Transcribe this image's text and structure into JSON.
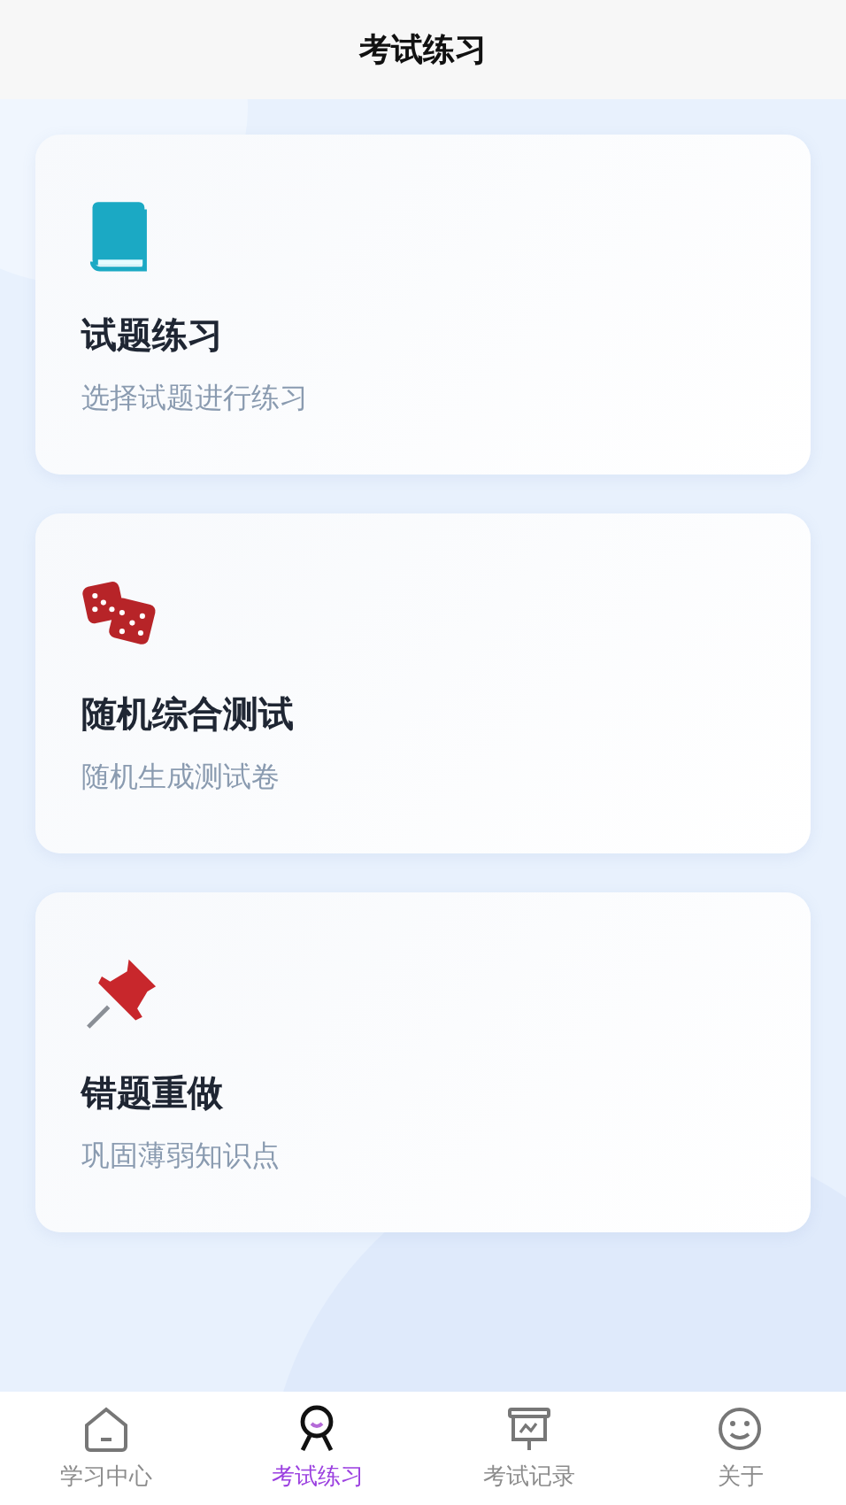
{
  "header": {
    "title": "考试练习"
  },
  "cards": [
    {
      "kind": "book",
      "title": "试题练习",
      "subtitle": "选择试题进行练习"
    },
    {
      "kind": "dice",
      "title": "随机综合测试",
      "subtitle": "随机生成测试卷"
    },
    {
      "kind": "pin",
      "title": "错题重做",
      "subtitle": "巩固薄弱知识点"
    }
  ],
  "tab_bar": [
    {
      "kind": "home",
      "label": "学习中心",
      "selected": false
    },
    {
      "kind": "person",
      "label": "考试练习",
      "selected": true
    },
    {
      "kind": "board",
      "label": "考试记录",
      "selected": false
    },
    {
      "kind": "smile",
      "label": "关于",
      "selected": false
    }
  ]
}
